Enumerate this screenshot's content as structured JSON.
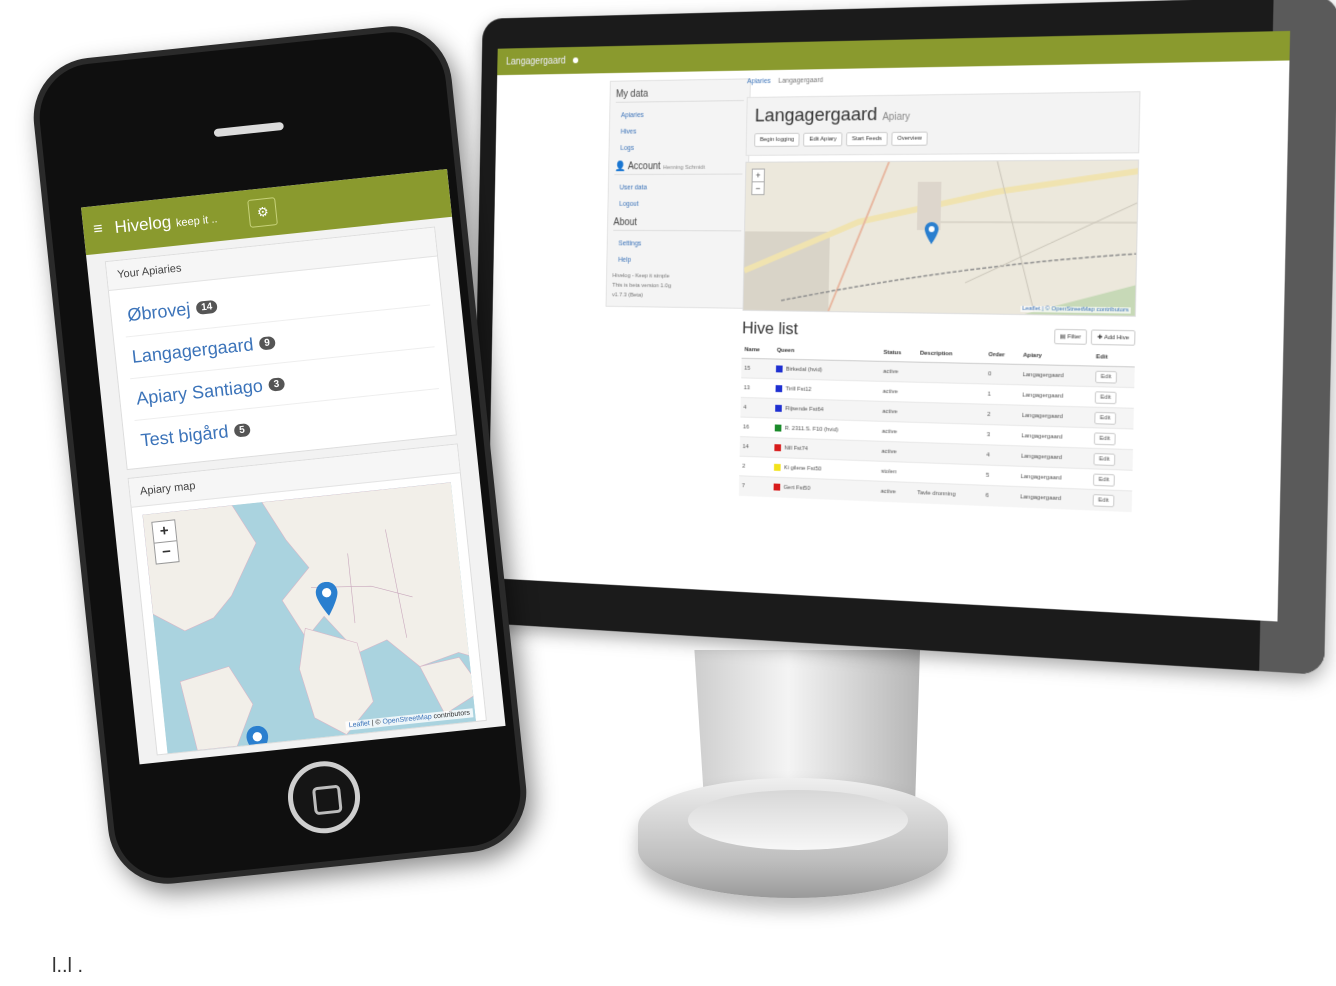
{
  "desktop": {
    "topbar": {
      "app_label": "Langagergaard"
    },
    "sidebar": {
      "my_data": "My data",
      "my_data_links": [
        "Apiaries",
        "Hives",
        "Logs"
      ],
      "account": "Account",
      "account_sub": "Henning Schmidt",
      "account_links": [
        "User data",
        "Logout"
      ],
      "about": "About",
      "about_links": [
        "Settings",
        "Help"
      ],
      "notes": [
        "Hivelog - Keep it simple",
        "This is beta version 1.0g",
        "v1.7.3 (Beta)"
      ]
    },
    "breadcrumb": {
      "root": "Apiaries",
      "current": "Langagergaard"
    },
    "apiary": {
      "title": "Langagergaard",
      "subtitle": "Apiary",
      "buttons": [
        "Begin logging",
        "Edit Apiary",
        "Start Feeds",
        "Overview"
      ]
    },
    "map": {
      "zoom_in": "+",
      "zoom_out": "−",
      "attribution": "Leaflet | © OpenStreetMap contributors"
    },
    "hive_list": {
      "title": "Hive list",
      "tools": [
        "Filter",
        "Add Hive"
      ],
      "columns": [
        "Name",
        "Queen",
        "Status",
        "Description",
        "Order",
        "Apiary",
        "Edit"
      ],
      "rows": [
        {
          "name": "15",
          "queen": "Birkedal (hvid)",
          "color": "#1e2fd1",
          "status": "active",
          "description": "",
          "order": "0",
          "apiary": "Langagergaard",
          "edit": "Edit"
        },
        {
          "name": "13",
          "queen": "Tirill Fst12",
          "color": "#1e2fd1",
          "status": "active",
          "description": "",
          "order": "1",
          "apiary": "Langagergaard",
          "edit": "Edit"
        },
        {
          "name": "4",
          "queen": "Flijsende Fst64",
          "color": "#1e2fd1",
          "status": "active",
          "description": "",
          "order": "2",
          "apiary": "Langagergaard",
          "edit": "Edit"
        },
        {
          "name": "16",
          "queen": "R. 2311.S. F10 (hvid)",
          "color": "#1a8a2a",
          "status": "active",
          "description": "",
          "order": "3",
          "apiary": "Langagergaard",
          "edit": "Edit"
        },
        {
          "name": "14",
          "queen": "Nill Fst74",
          "color": "#d81b1b",
          "status": "active",
          "description": "",
          "order": "4",
          "apiary": "Langagergaard",
          "edit": "Edit"
        },
        {
          "name": "2",
          "queen": "Ki gilene Fst50",
          "color": "#f2e21a",
          "status": "stolen",
          "description": "",
          "order": "5",
          "apiary": "Langagergaard",
          "edit": "Edit"
        },
        {
          "name": "7",
          "queen": "Gert Fst50",
          "color": "#d81b1b",
          "status": "active",
          "description": "Tavle dronning",
          "order": "6",
          "apiary": "Langagergaard",
          "edit": "Edit"
        }
      ]
    }
  },
  "phone": {
    "topbar": {
      "brand": "Hivelog",
      "tagline": "keep it ..",
      "menu_icon": "≡",
      "gear_icon": "⚙"
    },
    "apiaries": {
      "heading": "Your Apiaries",
      "items": [
        {
          "name": "Øbrovej",
          "count": "14"
        },
        {
          "name": "Langagergaard",
          "count": "9"
        },
        {
          "name": "Apiary Santiago",
          "count": "3"
        },
        {
          "name": "Test bigård",
          "count": "5"
        }
      ]
    },
    "map": {
      "heading": "Apiary map",
      "zoom_in": "+",
      "zoom_out": "−",
      "attribution_leaflet": "Leaflet",
      "attribution_rest": " | © ",
      "attribution_osm": "OpenStreetMap",
      "attribution_tail": " contributors"
    }
  },
  "footer_mark": "l..l ."
}
